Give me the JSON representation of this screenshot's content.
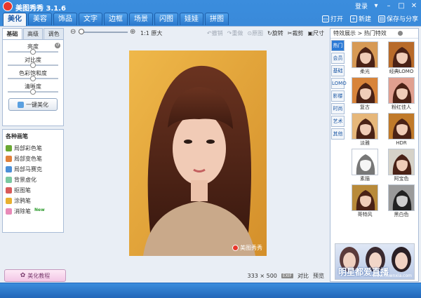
{
  "app": {
    "title": "美图秀秀 3.1.6"
  },
  "titlebar": {
    "login": "登录",
    "skin": "",
    "menu": "▾",
    "minimize": "–",
    "maximize": "□",
    "close": "✕"
  },
  "tabs": [
    {
      "label": "美化",
      "active": true
    },
    {
      "label": "美容"
    },
    {
      "label": "饰品"
    },
    {
      "label": "文字"
    },
    {
      "label": "边框"
    },
    {
      "label": "场景"
    },
    {
      "label": "闪图"
    },
    {
      "label": "娃娃"
    },
    {
      "label": "拼图"
    }
  ],
  "actions": {
    "open": "打开",
    "new": "新建",
    "save": "保存与分享"
  },
  "left": {
    "subtabs": [
      "基础",
      "高级",
      "调色"
    ],
    "sliders": [
      {
        "label": "亮度",
        "value": 0.5
      },
      {
        "label": "对比度",
        "value": 0.5
      },
      {
        "label": "色彩饱和度",
        "value": 0.5
      },
      {
        "label": "清晰度",
        "value": 0.5
      }
    ],
    "onekey": "一键美化",
    "brushes_title": "各种画笔",
    "brushes": [
      {
        "label": "局部彩色笔",
        "color": "#6aa834"
      },
      {
        "label": "局部变色笔",
        "color": "#e0803a"
      },
      {
        "label": "局部马赛克",
        "color": "#4a8fd8"
      },
      {
        "label": "背景虚化",
        "color": "#7ac8a0"
      },
      {
        "label": "抠图笔",
        "color": "#d85a5a"
      },
      {
        "label": "涂鸦笔",
        "color": "#e8b030"
      },
      {
        "label": "消除笔",
        "color": "#e88ab8",
        "badge": "New"
      }
    ],
    "tutorial": "美化教程"
  },
  "center": {
    "zoom": {
      "minus": "⊖",
      "plus": "⊕",
      "value": 0.05
    },
    "original_size": "1:1 原大",
    "tools": [
      {
        "label": "↶撤销",
        "disabled": true
      },
      {
        "label": "↷重做",
        "disabled": true
      },
      {
        "label": "⊙原图",
        "disabled": true
      },
      {
        "label": "↻旋转"
      },
      {
        "label": "✂裁剪"
      },
      {
        "label": "▣尺寸"
      }
    ],
    "watermark": "美图秀秀",
    "dimensions": "333 × 500",
    "exif": "EXIF",
    "compare": "对比",
    "preview": "预览"
  },
  "right": {
    "header": "特效展示 > 热门特效",
    "categories": [
      {
        "label": "热门",
        "active": true
      },
      {
        "label": "会员"
      },
      {
        "label": "基础"
      },
      {
        "label": "LOMO"
      },
      {
        "label": "影楼"
      },
      {
        "label": "时尚"
      },
      {
        "label": "艺术"
      },
      {
        "label": "其他"
      }
    ],
    "effects": [
      {
        "label": "柔光",
        "tone": "#d79a55"
      },
      {
        "label": "经典LOMO",
        "tone": "#b86b2a"
      },
      {
        "label": "复古",
        "tone": "#d8843a"
      },
      {
        "label": "粉红佳人",
        "tone": "#e0a090"
      },
      {
        "label": "淡雅",
        "tone": "#e6b77a"
      },
      {
        "label": "HDR",
        "tone": "#c07a2a"
      },
      {
        "label": "素描",
        "tone": "#ffffff"
      },
      {
        "label": "阿宝色",
        "tone": "#d6d2c8"
      },
      {
        "label": "哥特风",
        "tone": "#b88a3a"
      },
      {
        "label": "黑白色",
        "tone": "#9a9a9a"
      }
    ],
    "banner": {
      "text": "明星都爱直播",
      "site": "www.downxia.com"
    }
  }
}
